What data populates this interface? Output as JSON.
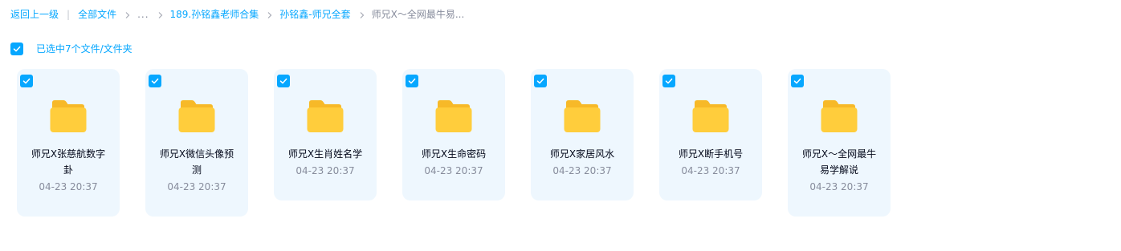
{
  "breadcrumb": {
    "back": "返回上一级",
    "separator": "|",
    "root": "全部文件",
    "ellipsis": "...",
    "level1": "189.孙铭鑫老师合集",
    "level2": "孙铭鑫-师兄全套",
    "current": "师兄X～全网最牛易..."
  },
  "selection": {
    "checked": true,
    "label": "已选中7个文件/文件夹"
  },
  "colors": {
    "accent": "#06a7ff",
    "card_bg": "#eef7fe",
    "folder": "#ffc933",
    "text": "#03081a",
    "muted": "#878c9c"
  },
  "files": [
    {
      "name": "师兄X张慈航数字卦",
      "date": "04-23 20:37",
      "icon": "folder-icon",
      "checked": true
    },
    {
      "name": "师兄X微信头像预测",
      "date": "04-23 20:37",
      "icon": "folder-icon",
      "checked": true
    },
    {
      "name": "师兄X生肖姓名学",
      "date": "04-23 20:37",
      "icon": "folder-icon",
      "checked": true
    },
    {
      "name": "师兄X生命密码",
      "date": "04-23 20:37",
      "icon": "folder-icon",
      "checked": true
    },
    {
      "name": "师兄X家居风水",
      "date": "04-23 20:37",
      "icon": "folder-icon",
      "checked": true
    },
    {
      "name": "师兄X断手机号",
      "date": "04-23 20:37",
      "icon": "folder-icon",
      "checked": true
    },
    {
      "name": "师兄X～全网最牛易学解说",
      "date": "04-23 20:37",
      "icon": "folder-icon",
      "checked": true
    }
  ]
}
